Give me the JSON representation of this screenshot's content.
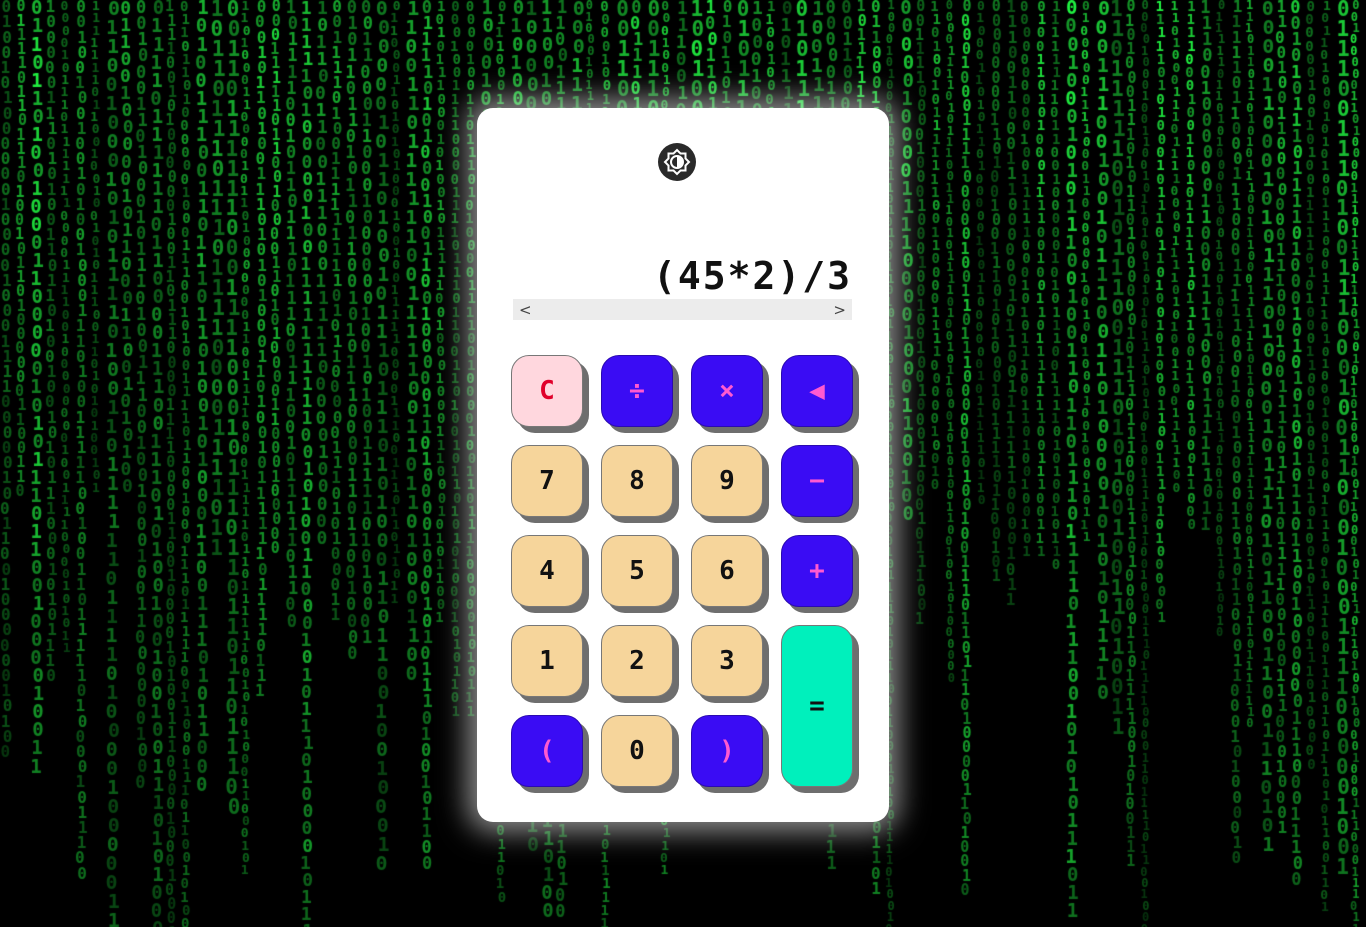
{
  "display": {
    "expression": "(45*2)/3",
    "scroll_left": "<",
    "scroll_right": ">"
  },
  "theme_toggle": {
    "icon": "theme-toggle-icon"
  },
  "keys": {
    "clear": "C",
    "divide": "÷",
    "multiply": "×",
    "backspace": "◀",
    "seven": "7",
    "eight": "8",
    "nine": "9",
    "minus": "−",
    "four": "4",
    "five": "5",
    "six": "6",
    "plus": "+",
    "one": "1",
    "two": "2",
    "three": "3",
    "equals": "=",
    "open_paren": "(",
    "zero": "0",
    "close_paren": ")"
  },
  "colors": {
    "number_key": "#f6d59b",
    "operator_key": "#3a0cf4",
    "operator_text": "#ff5ad0",
    "clear_key": "#ffd7de",
    "clear_text": "#e0002a",
    "equals_key": "#00f0bc",
    "background_code": "#22ff44"
  }
}
